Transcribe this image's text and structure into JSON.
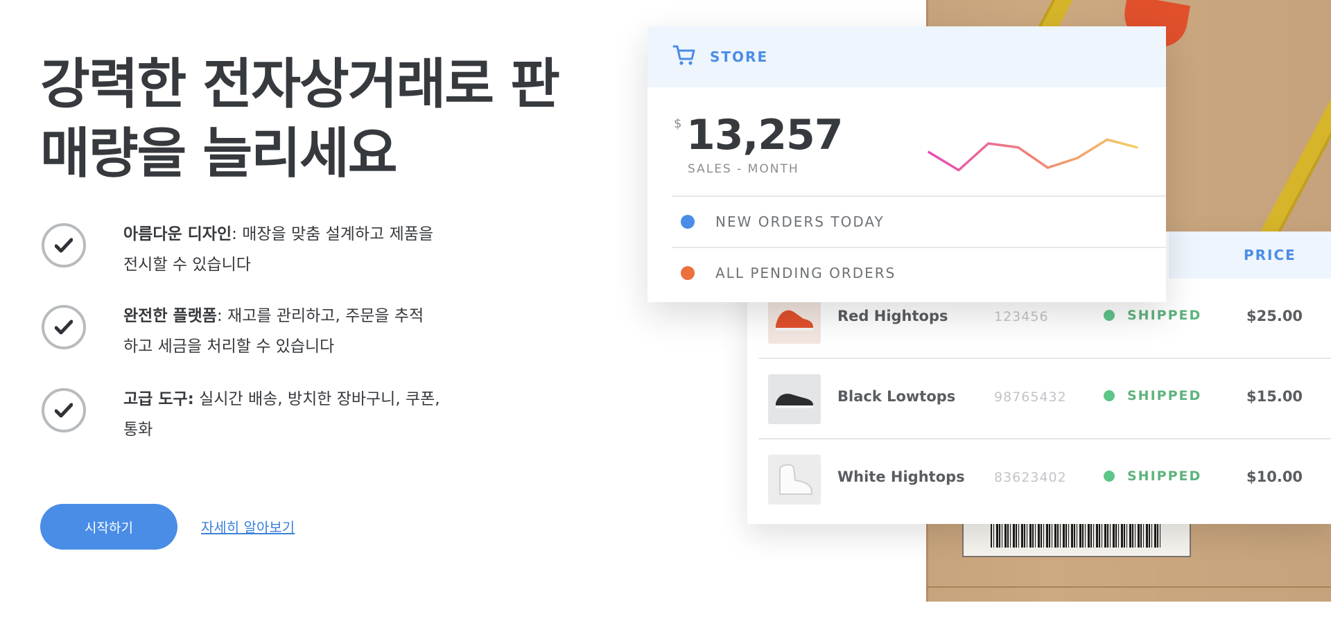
{
  "hero": {
    "title_line1": "강력한 전자상거래로 판",
    "title_line2": "매량을 늘리세요"
  },
  "features": [
    {
      "bold": "아름다운 디자인",
      "text": ": 매장을 맞춤 설계하고 제품을",
      "text2": "전시할 수 있습니다"
    },
    {
      "bold": "완전한 플랫폼",
      "text": ": 재고를 관리하고, 주문을 추적",
      "text2": "하고 세금을 처리할 수 있습니다"
    },
    {
      "bold": "고급 도구:",
      "text": " 실시간 배송, 방치한 장바구니, 쿠폰,",
      "text2": "통화"
    }
  ],
  "cta": {
    "primary_label": "시작하기",
    "link_label": "자세히 알아보기"
  },
  "store_card": {
    "header": "STORE",
    "currency": "$",
    "sales_value": "13,257",
    "sales_caption": "SALES - MONTH",
    "rows": [
      {
        "label": "NEW ORDERS TODAY",
        "color": "#4a8de6"
      },
      {
        "label": "ALL PENDING ORDERS",
        "color": "#ec6f3d"
      }
    ],
    "sparkline": [
      0.62,
      0.25,
      0.8,
      0.72,
      0.3,
      0.5,
      0.88,
      0.72
    ]
  },
  "orders": {
    "price_header": "PRICE",
    "rows": [
      {
        "name": "Red Hightops",
        "sku": "123456",
        "status": "SHIPPED",
        "price": "$25.00"
      },
      {
        "name": "Black Lowtops",
        "sku": "98765432",
        "status": "SHIPPED",
        "price": "$15.00"
      },
      {
        "name": "White Hightops",
        "sku": "83623402",
        "status": "SHIPPED",
        "price": "$10.00"
      }
    ]
  },
  "colors": {
    "accent": "#4a8de6",
    "shipped": "#5fc488",
    "pending": "#ec6f3d"
  }
}
